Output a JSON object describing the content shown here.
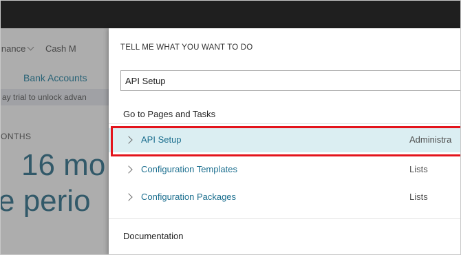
{
  "background_app": {
    "nav_items": [
      "inance",
      "Cash M"
    ],
    "bank_accounts_label": "Bank Accounts",
    "trial_banner": "ay trial to unlock advan",
    "months_label": "ONTHS",
    "big_value": "16 mo",
    "big_period": "e perio"
  },
  "panel": {
    "title": "TELL ME WHAT YOU WANT TO DO",
    "search_value": "API Setup",
    "section_pages": "Go to Pages and Tasks",
    "section_docs": "Documentation",
    "results": [
      {
        "label": "API Setup",
        "category": "Administra"
      },
      {
        "label": "Configuration Templates",
        "category": "Lists"
      },
      {
        "label": "Configuration Packages",
        "category": "Lists"
      }
    ]
  },
  "colors": {
    "topbar": "#1f1f1f",
    "link": "#1c6f8f",
    "selected_row": "#dbeef2",
    "highlight_border": "#e3141c"
  }
}
